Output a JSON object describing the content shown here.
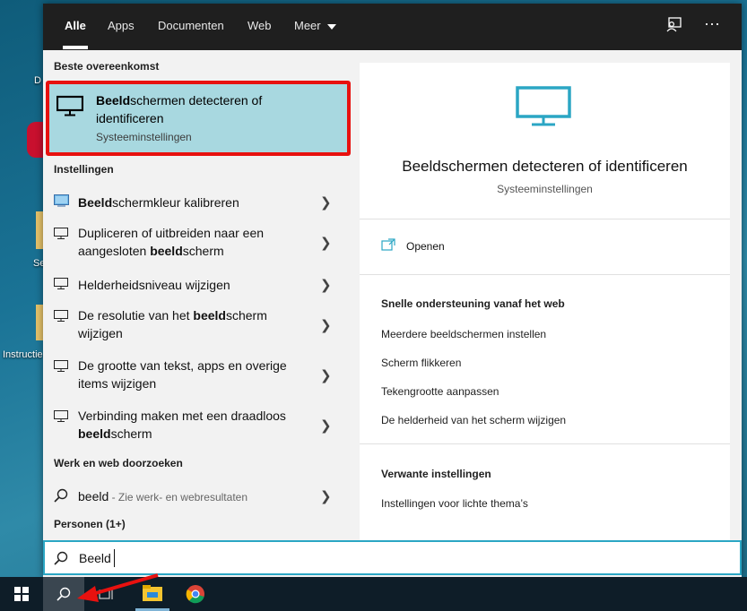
{
  "desktop": {
    "labels": [
      "D",
      "Se",
      "Instructie"
    ]
  },
  "tabs": [
    "Alle",
    "Apps",
    "Documenten",
    "Web",
    "Meer"
  ],
  "top_icons": [
    "feedback-icon",
    "more-icon"
  ],
  "left": {
    "best_match_heading": "Beste overeenkomst",
    "best_match": {
      "title_bold": "Beeld",
      "title_rest": "schermen detecteren of identificeren",
      "subtitle": "Systeeminstellingen"
    },
    "settings_heading": "Instellingen",
    "settings": [
      {
        "bold": "Beeld",
        "rest": "schermkleur kalibreren",
        "pre": ""
      },
      {
        "pre": "Dupliceren of uitbreiden naar een aangesloten ",
        "bold": "beeld",
        "rest": "scherm"
      },
      {
        "pre": "Helderheidsniveau wijzigen",
        "bold": "",
        "rest": ""
      },
      {
        "pre": "De resolutie van het ",
        "bold": "beeld",
        "rest": "scherm wijzigen"
      },
      {
        "pre": "De grootte van tekst, apps en overige items wijzigen",
        "bold": "",
        "rest": ""
      },
      {
        "pre": "Verbinding maken met een draadloos ",
        "bold": "beeld",
        "rest": "scherm"
      }
    ],
    "web_heading": "Werk en web doorzoeken",
    "web_query": "beeld",
    "web_hint": " - Zie werk- en webresultaten",
    "people_heading": "Personen (1+)"
  },
  "right": {
    "title": "Beeldschermen detecteren of identificeren",
    "subtitle": "Systeeminstellingen",
    "open_label": "Openen",
    "web_heading": "Snelle ondersteuning vanaf het web",
    "web_links": [
      "Meerdere beeldschermen instellen",
      "Scherm flikkeren",
      "Tekengrootte aanpassen",
      "De helderheid van het scherm wijzigen"
    ],
    "related_heading": "Verwante instellingen",
    "related_links": [
      "Instellingen voor lichte thema’s"
    ]
  },
  "search": {
    "value": "Beeld"
  },
  "colors": {
    "accent": "#2ba6c4",
    "highlight": "#a8d8e0",
    "annotation_red": "#e8110f"
  }
}
